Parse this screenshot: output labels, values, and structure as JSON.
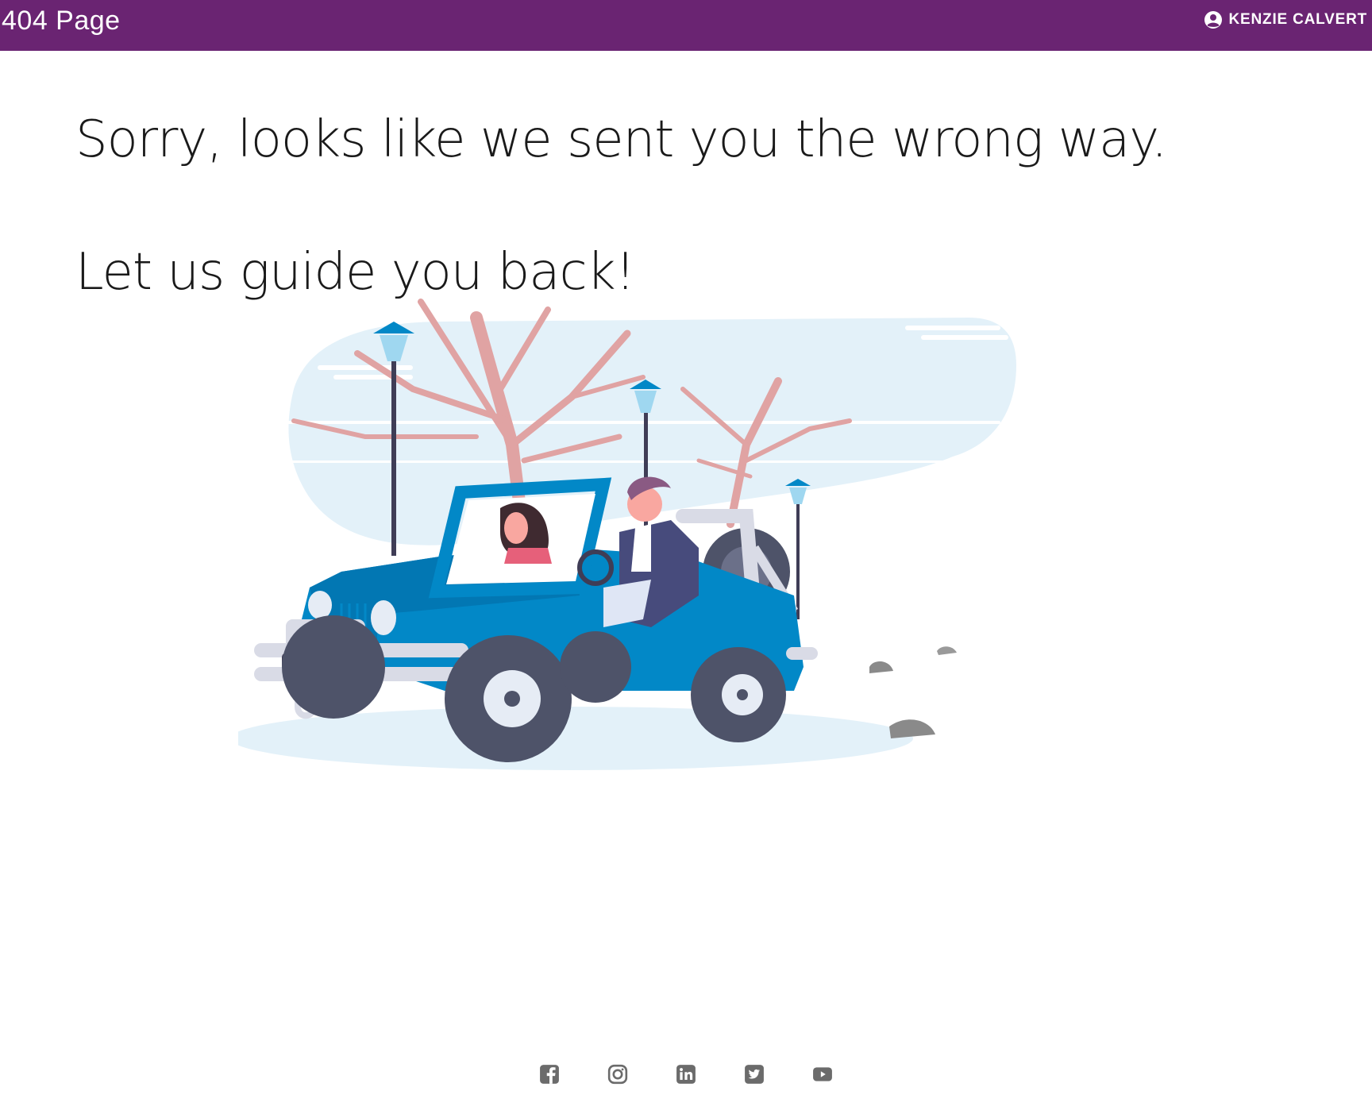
{
  "header": {
    "title": "404 Page",
    "user_name": "KENZIE CALVERT",
    "user_icon": "account-circle-icon",
    "background_color": "#6a2472"
  },
  "main": {
    "line1": "Sorry, looks like we sent you the wrong way.",
    "line2": "Let us guide you back!",
    "illustration": "jeep-driving-illustration"
  },
  "footer": {
    "social_icons": [
      "facebook-icon",
      "instagram-icon",
      "linkedin-icon",
      "twitter-icon",
      "youtube-icon"
    ],
    "icon_color": "#6b6b6b"
  }
}
